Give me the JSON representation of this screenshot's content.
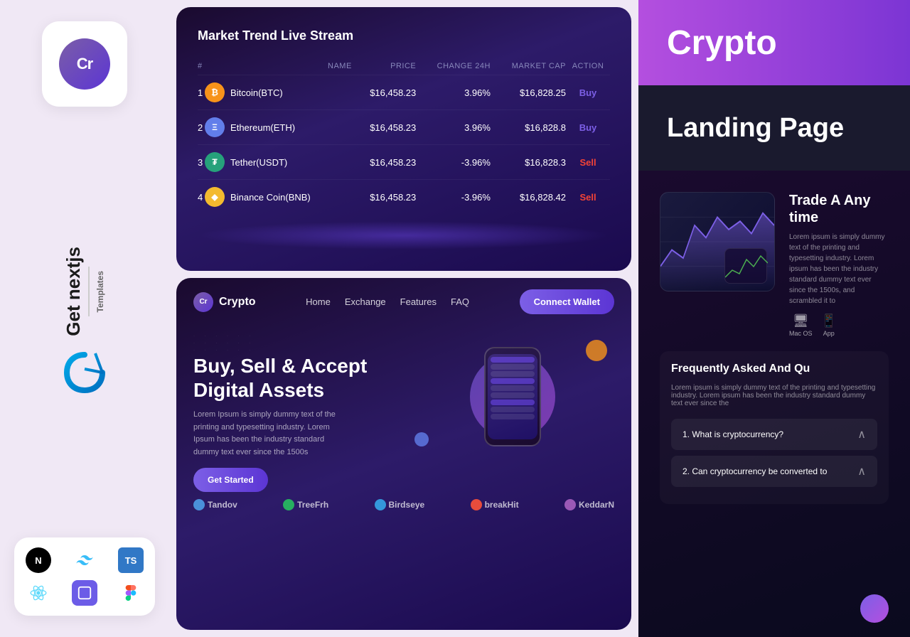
{
  "app": {
    "name": "Crypto Landing Page",
    "logo_text": "Cr"
  },
  "sidebar": {
    "logo_text": "Cr",
    "brand_main": "Get nextjs",
    "brand_sub": "Templates",
    "tech_icons": [
      {
        "name": "Next.js",
        "symbol": "N",
        "type": "next"
      },
      {
        "name": "Tailwind CSS",
        "symbol": "~",
        "type": "tailwind"
      },
      {
        "name": "TypeScript",
        "symbol": "TS",
        "type": "ts"
      },
      {
        "name": "React",
        "symbol": "⚛",
        "type": "react"
      },
      {
        "name": "Sequence",
        "symbol": "▢",
        "type": "sequence"
      },
      {
        "name": "Figma",
        "symbol": "◈",
        "type": "figma"
      }
    ]
  },
  "market_table": {
    "title": "Market Trend Live Stream",
    "columns": [
      "#",
      "NAME",
      "PRICE",
      "CHANGE 24H",
      "MARKET CAP",
      "ACTION"
    ],
    "rows": [
      {
        "num": "1",
        "name": "Bitcoin(BTC)",
        "price": "$16,458.23",
        "change": "3.96%",
        "change_type": "positive",
        "market_cap": "$16,828.25",
        "action": "Buy",
        "action_type": "buy"
      },
      {
        "num": "2",
        "name": "Ethereum(ETH)",
        "price": "$16,458.23",
        "change": "3.96%",
        "change_type": "positive",
        "market_cap": "$16,828.8",
        "action": "Buy",
        "action_type": "buy"
      },
      {
        "num": "3",
        "name": "Tether(USDT)",
        "price": "$16,458.23",
        "change": "-3.96%",
        "change_type": "negative",
        "market_cap": "$16,828.3",
        "action": "Sell",
        "action_type": "sell"
      },
      {
        "num": "4",
        "name": "Binance Coin(BNB)",
        "price": "$16,458.23",
        "change": "-3.96%",
        "change_type": "negative",
        "market_cap": "$16,828.42",
        "action": "Sell",
        "action_type": "sell"
      }
    ]
  },
  "landing": {
    "logo_text": "Cr",
    "brand": "Crypto",
    "nav": [
      "Home",
      "Exchange",
      "Features",
      "FAQ"
    ],
    "cta_button": "Connect Wallet",
    "hero_title": "Buy, Sell & Accept Digital Assets",
    "hero_desc": "Lorem Ipsum is simply dummy text of the printing and typesetting industry. Lorem Ipsum has been the industry standard dummy text ever since the 1500s",
    "hero_cta": "Get Started",
    "partners": [
      "Tandov",
      "TreeFrh",
      "Birdseye",
      "breakHit",
      "KeddarN"
    ]
  },
  "right_panel": {
    "crypto_label": "Crypto",
    "landing_label": "Landing Page",
    "trade_title": "Trade A Any time",
    "trade_desc": "Lorem ipsum is simply dummy text of the printing and typesetting industry. Lorem ipsum has been the industry standard dummy text ever since the 1500s, and scrambled it to",
    "os_labels": [
      "Mac OS",
      "App"
    ],
    "faq_title": "Frequently Asked And Qu",
    "faq_subtitle": "Lorem ipsum is simply dummy text of the printing and typesetting industry. Lorem ipsum has been the industry standard dummy text ever since the",
    "faq_items": [
      {
        "question": "1. What is cryptocurrency?",
        "expanded": true
      },
      {
        "question": "2. Can cryptocurrency be converted to",
        "expanded": true
      }
    ]
  }
}
